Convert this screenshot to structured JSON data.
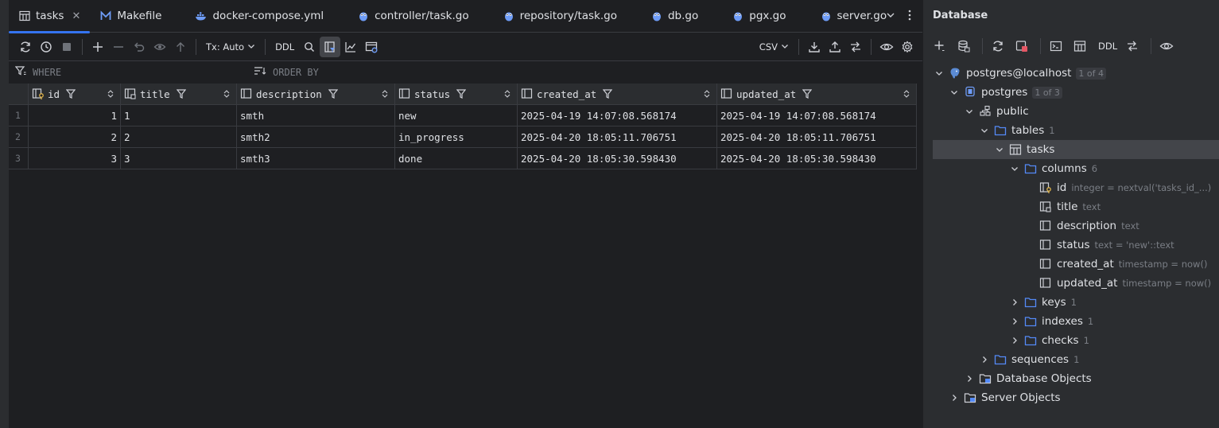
{
  "tabs": [
    {
      "label": "tasks",
      "icon": "table-icon",
      "active": true
    },
    {
      "label": "Makefile",
      "icon": "makefile-icon"
    },
    {
      "label": "docker-compose.yml",
      "icon": "docker-icon"
    },
    {
      "label": "controller/task.go",
      "icon": "gopher-icon"
    },
    {
      "label": "repository/task.go",
      "icon": "gopher-icon"
    },
    {
      "label": "db.go",
      "icon": "gopher-icon"
    },
    {
      "label": "pgx.go",
      "icon": "gopher-icon"
    },
    {
      "label": "server.go",
      "icon": "gopher-icon"
    }
  ],
  "toolbar": {
    "tx_label": "Tx: Auto",
    "ddl_label": "DDL",
    "csv_label": "CSV"
  },
  "filters": {
    "where_placeholder": "WHERE",
    "order_placeholder": "ORDER BY"
  },
  "grid": {
    "columns": [
      {
        "name": "id",
        "icon": "key-column-icon"
      },
      {
        "name": "title",
        "icon": "notnull-column-icon"
      },
      {
        "name": "description",
        "icon": "column-icon"
      },
      {
        "name": "status",
        "icon": "column-icon"
      },
      {
        "name": "created_at",
        "icon": "column-icon"
      },
      {
        "name": "updated_at",
        "icon": "column-icon"
      }
    ],
    "rows": [
      {
        "n": "1",
        "id": "1",
        "title": "1",
        "description": "smth",
        "status": "new",
        "created_at": "2025-04-19 14:07:08.568174",
        "updated_at": "2025-04-19 14:07:08.568174"
      },
      {
        "n": "2",
        "id": "2",
        "title": "2",
        "description": "smth2",
        "status": "in_progress",
        "created_at": "2025-04-20 18:05:11.706751",
        "updated_at": "2025-04-20 18:05:11.706751"
      },
      {
        "n": "3",
        "id": "3",
        "title": "3",
        "description": "smth3",
        "status": "done",
        "created_at": "2025-04-20 18:05:30.598430",
        "updated_at": "2025-04-20 18:05:30.598430"
      }
    ]
  },
  "db_panel": {
    "title": "Database",
    "ddl_label": "DDL",
    "tree": {
      "datasource": {
        "label": "postgres@localhost",
        "badge": "1 of 4"
      },
      "database": {
        "label": "postgres",
        "badge": "1 of 3"
      },
      "schema": {
        "label": "public"
      },
      "tables": {
        "label": "tables",
        "count": "1"
      },
      "table": {
        "label": "tasks"
      },
      "columns": {
        "label": "columns",
        "count": "6"
      },
      "column_items": [
        {
          "name": "id",
          "meta": "integer = nextval('tasks_id_...)",
          "icon": "key-column-icon"
        },
        {
          "name": "title",
          "meta": "text",
          "icon": "notnull-column-icon"
        },
        {
          "name": "description",
          "meta": "text",
          "icon": "column-icon"
        },
        {
          "name": "status",
          "meta": "text = 'new'::text",
          "icon": "column-icon"
        },
        {
          "name": "created_at",
          "meta": "timestamp = now()",
          "icon": "column-icon"
        },
        {
          "name": "updated_at",
          "meta": "timestamp = now()",
          "icon": "column-icon"
        }
      ],
      "keys": {
        "label": "keys",
        "count": "1"
      },
      "indexes": {
        "label": "indexes",
        "count": "1"
      },
      "checks": {
        "label": "checks",
        "count": "1"
      },
      "sequences": {
        "label": "sequences",
        "count": "1"
      },
      "database_objects": {
        "label": "Database Objects"
      },
      "server_objects": {
        "label": "Server Objects"
      }
    }
  },
  "colors": {
    "accent": "#3574f0",
    "background": "#1e1f22",
    "panel": "#2b2d30",
    "folder": "#548af7",
    "stop": "#e55765"
  }
}
